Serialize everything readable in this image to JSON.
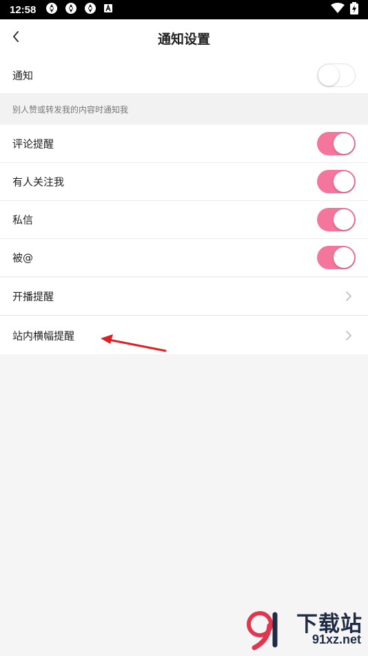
{
  "status_bar": {
    "time": "12:58"
  },
  "header": {
    "title": "通知设置"
  },
  "notify_master": {
    "label": "通知",
    "enabled": false
  },
  "section_hint": "别人赞或转发我的内容时通知我",
  "items": [
    {
      "label": "评论提醒",
      "enabled": true
    },
    {
      "label": "有人关注我",
      "enabled": true
    },
    {
      "label": "私信",
      "enabled": true
    },
    {
      "label": "被@",
      "enabled": true
    },
    {
      "label": "开播提醒"
    },
    {
      "label": "站内横幅提醒"
    }
  ],
  "watermark": {
    "name": "下载站",
    "site": "91xz.net"
  },
  "colors": {
    "toggle_on": "#f5769c",
    "annotation_arrow": "#e02020"
  }
}
